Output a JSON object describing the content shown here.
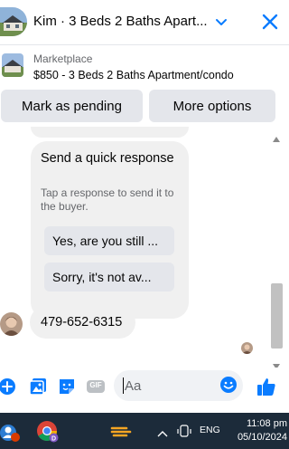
{
  "header": {
    "title": "Kim · 3 Beds 2 Baths Apart...",
    "chevron_icon": "chevron-down-icon",
    "close_icon": "close-icon"
  },
  "marketplace": {
    "label": "Marketplace",
    "listing": "$850 - 3 Beds 2 Baths Apartment/condo"
  },
  "actions": {
    "mark_pending": "Mark as pending",
    "more_options": "More options"
  },
  "quick_response": {
    "title": "Send a quick response",
    "subtitle": "Tap a response to send it to the buyer.",
    "options": [
      "Yes, are you still ...",
      "Sorry, it's not av..."
    ]
  },
  "messages": [
    {
      "text": "479-652-6315"
    }
  ],
  "composer": {
    "placeholder": "Aa",
    "icons": [
      "plus-icon",
      "photo-icon",
      "sticker-icon",
      "gif-icon",
      "emoji-icon",
      "thumbs-up-icon"
    ],
    "gif_label": "GIF"
  },
  "taskbar": {
    "language": "ENG",
    "time": "11:08 pm",
    "date": "05/10/2024"
  },
  "colors": {
    "accent": "#0a7cff",
    "bubble": "#f0f0f0",
    "button": "#e4e6eb",
    "taskbar": "#1c2b3a"
  }
}
